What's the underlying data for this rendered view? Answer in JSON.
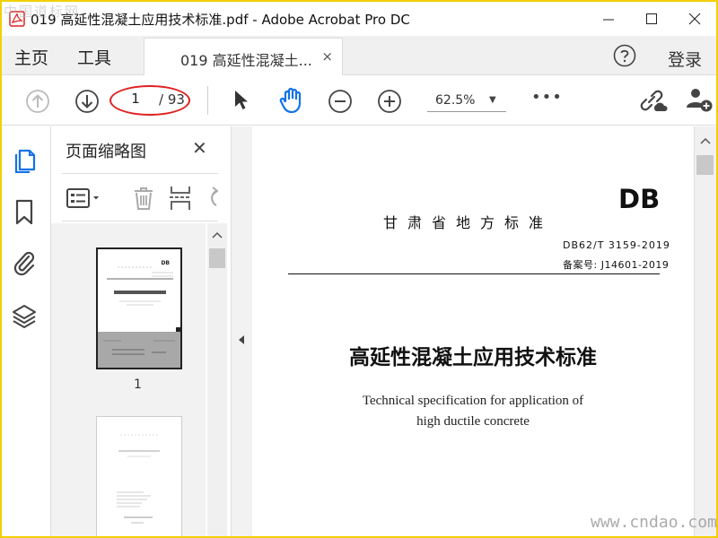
{
  "window": {
    "title": "019 高延性混凝土应用技术标准.pdf - Adobe Acrobat Pro DC"
  },
  "menu": {
    "home": "主页",
    "tools": "工具",
    "login": "登录"
  },
  "tab": {
    "label": "019 高延性混凝土...",
    "close": "×"
  },
  "toolbar": {
    "page_current": "1",
    "page_total": "/ 93",
    "zoom": "62.5%"
  },
  "panel": {
    "title": "页面缩略图",
    "thumbnail_page": "1"
  },
  "document": {
    "db": "DB",
    "region": "甘肃省地方标准",
    "code": "DB62/T 3159-2019",
    "record": "备案号: J14601-2019",
    "title_zh": "高延性混凝土应用技术标准",
    "title_en_line1": "Technical specification for application of",
    "title_en_line2": "high ductile concrete"
  },
  "watermark": {
    "top": "中国道标网",
    "bottom": "www.cndao.com"
  },
  "colors": {
    "accent": "#1473e6",
    "highlight_oval": "#e02020",
    "frame": "#f2d000"
  }
}
